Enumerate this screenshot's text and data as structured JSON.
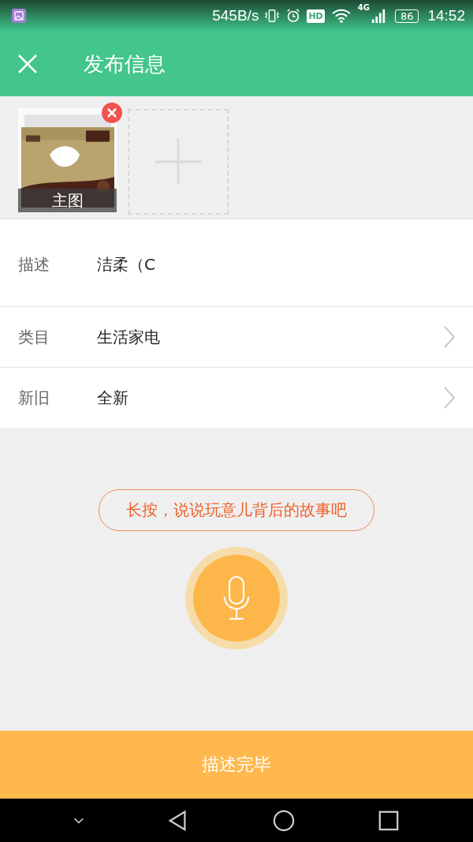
{
  "status_bar": {
    "net_speed": "545B/s",
    "hd": "HD",
    "network": "4G",
    "battery": "86",
    "time": "14:52"
  },
  "header": {
    "title": "发布信息"
  },
  "photos": [
    {
      "kind": "picture",
      "caption": "主图"
    }
  ],
  "fields": [
    {
      "label": "描述",
      "value": "洁柔（C",
      "kind": "text"
    },
    {
      "label": "类目",
      "value": "生活家电",
      "kind": "select"
    },
    {
      "label": "新旧",
      "value": "全新",
      "kind": "select"
    }
  ],
  "voice": {
    "hint": "长按，说说玩意儿背后的故事吧"
  },
  "submit": "描述完毕"
}
